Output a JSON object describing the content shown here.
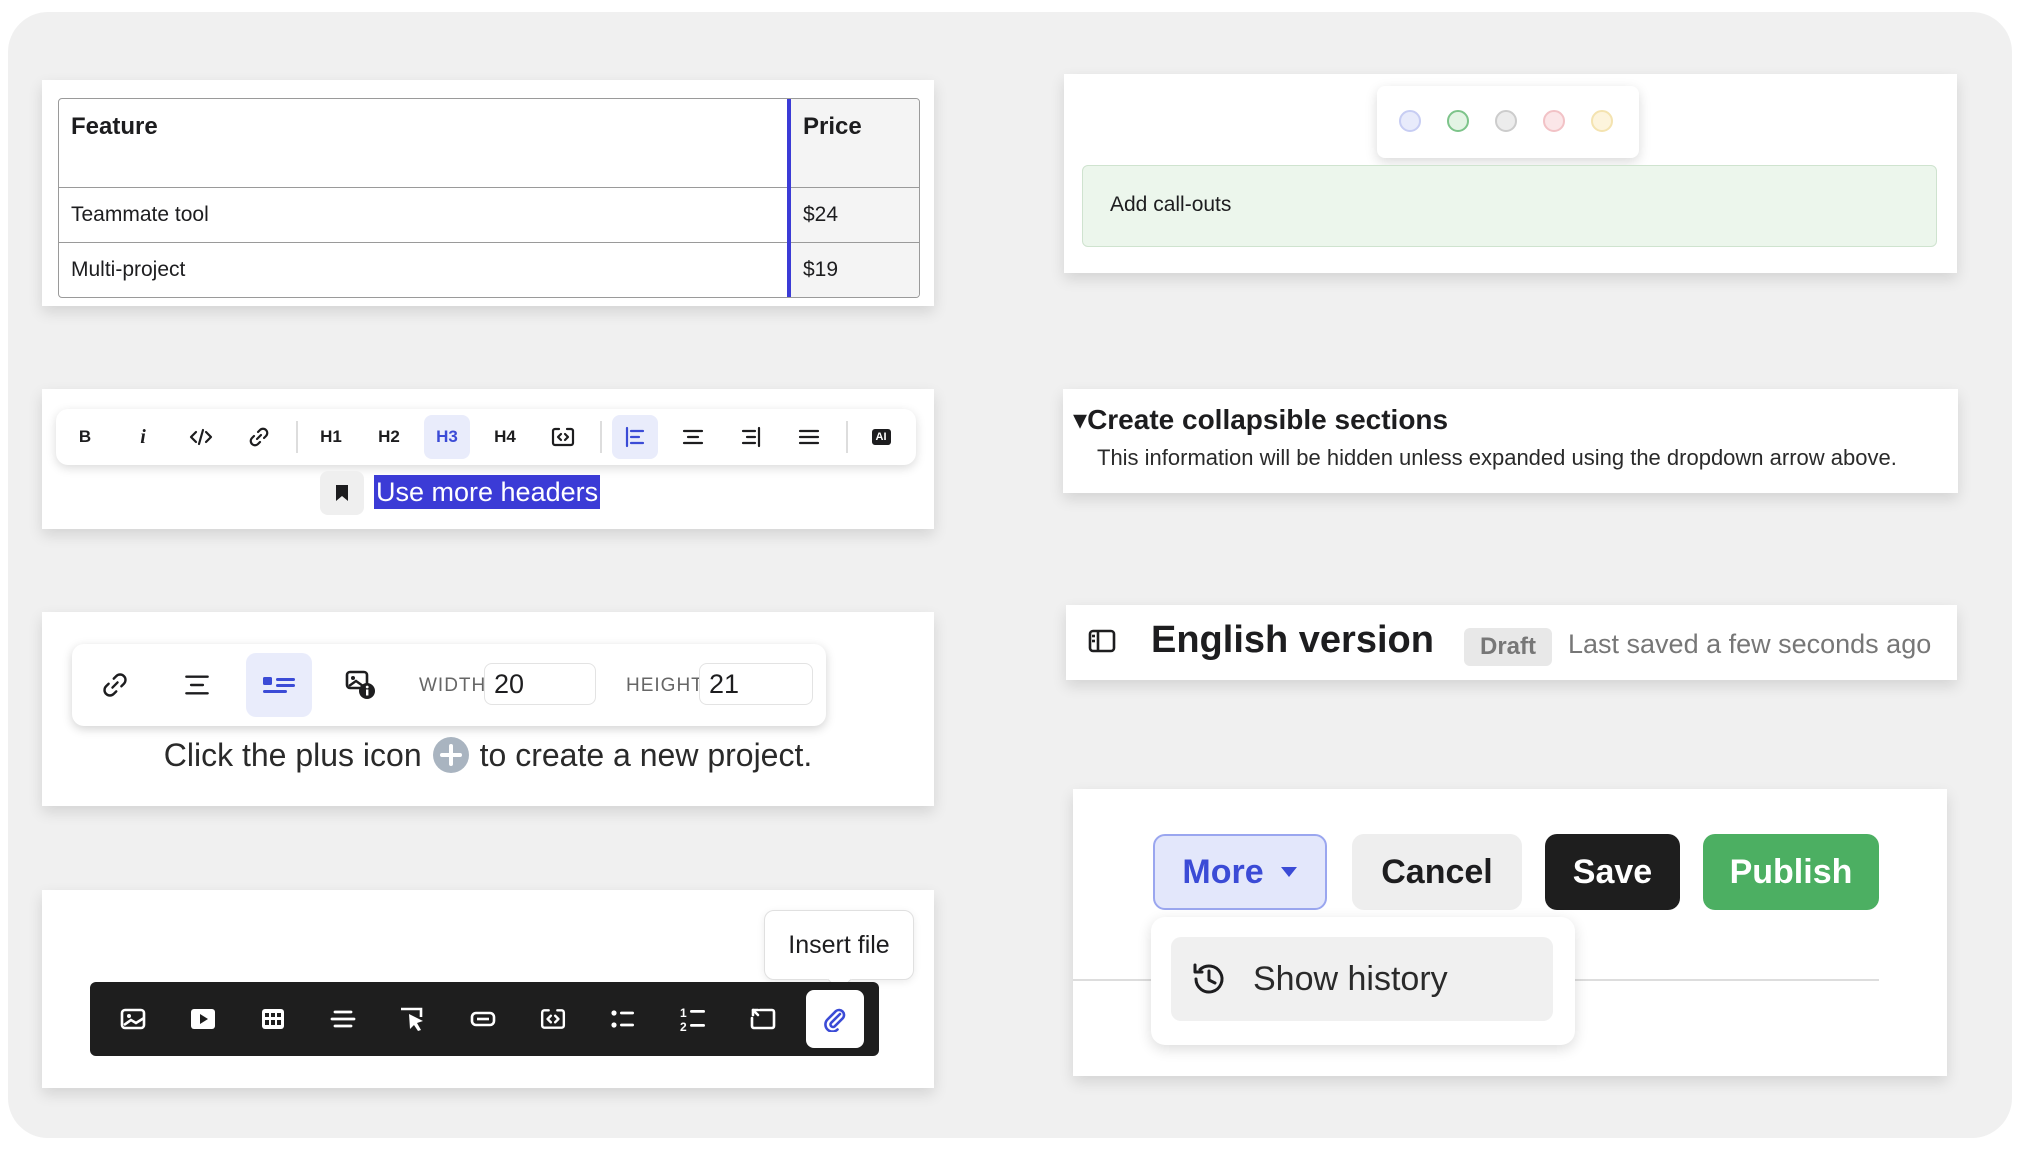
{
  "table": {
    "headers": [
      "Feature",
      "Price"
    ],
    "rows": [
      [
        "Teammate tool",
        "$24"
      ],
      [
        "Multi-project",
        "$19"
      ]
    ]
  },
  "format_toolbar": {
    "bold": "B",
    "italic": "i",
    "h1": "H1",
    "h2": "H2",
    "h3": "H3",
    "h4": "H4",
    "ai": "AI",
    "selected_text": "Use more headers",
    "active_color": "#3b4bd6"
  },
  "image_toolbar": {
    "width_label": "WIDTH",
    "width_value": "20",
    "height_label": "HEIGHT",
    "height_value": "21",
    "sentence_before": "Click the plus icon",
    "sentence_after": "to create a new project."
  },
  "insert_toolbar": {
    "tooltip": "Insert file",
    "icons": [
      "image-icon",
      "video-icon",
      "table-icon",
      "strikethrough-icon",
      "cursor-click-icon",
      "button-icon",
      "embed-icon",
      "bullet-list-icon",
      "numbered-list-icon",
      "redirect-icon",
      "attachment-icon"
    ]
  },
  "callout": {
    "text": "Add call-outs",
    "swatches": [
      "#e8ebfb",
      "#e3f4e4",
      "#ececec",
      "#fbe6e8",
      "#fdf4dc"
    ],
    "bg": "#ecf6ec"
  },
  "collapsible": {
    "arrow": "▾",
    "title": "Create collapsible sections",
    "body": "This information will be hidden unless expanded using the dropdown arrow above."
  },
  "doc_header": {
    "title": "English version",
    "badge": "Draft",
    "saved": "Last saved a few seconds ago"
  },
  "actions": {
    "more": "More",
    "cancel": "Cancel",
    "save": "Save",
    "publish": "Publish",
    "menu_item": "Show history",
    "publish_color": "#4caf62"
  }
}
